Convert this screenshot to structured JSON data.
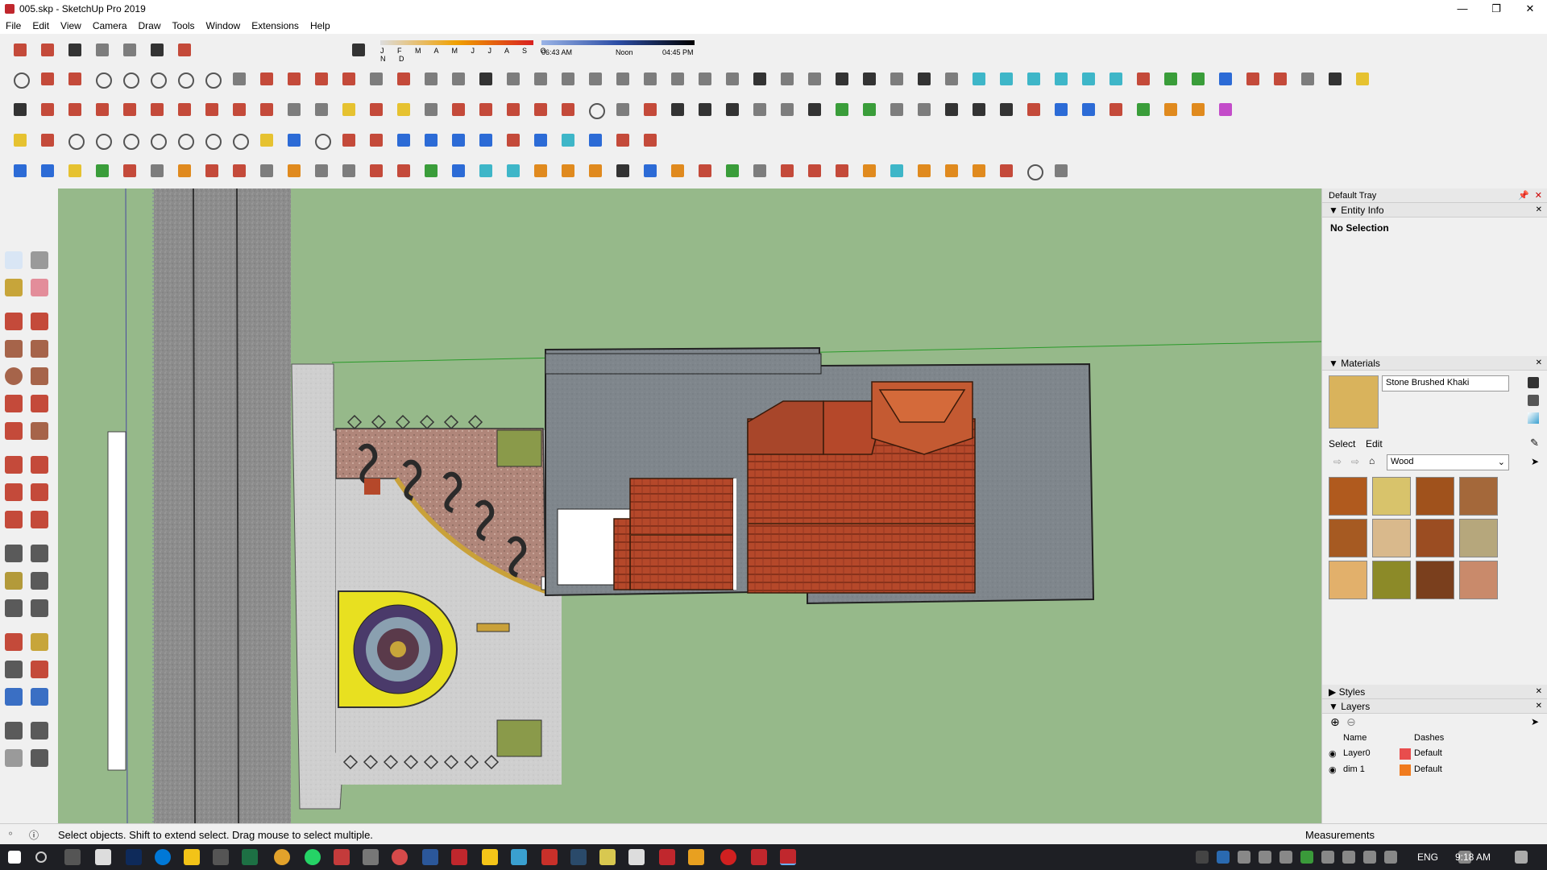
{
  "window": {
    "title": "005.skp - SketchUp Pro 2019",
    "minimize_icon": "minimize-icon",
    "maximize_icon": "restore-icon",
    "close_icon": "close-icon"
  },
  "menu": [
    "File",
    "Edit",
    "View",
    "Camera",
    "Draw",
    "Tools",
    "Window",
    "Extensions",
    "Help"
  ],
  "shadow_settings": {
    "months": "J F M A M J J A S O N D",
    "time_start": "06:43 AM",
    "time_mid": "Noon",
    "time_end": "04:45 PM"
  },
  "tray": {
    "title": "Default Tray",
    "entity_info": {
      "header": "Entity Info",
      "selection": "No Selection"
    },
    "materials": {
      "header": "Materials",
      "current_name": "Stone Brushed Khaki",
      "tab_select": "Select",
      "tab_edit": "Edit",
      "library": "Wood",
      "swatches": [
        "#b05a1e",
        "#d8c36b",
        "#a0521c",
        "#a4683a",
        "#a65a22",
        "#d9b98c",
        "#9b4d22",
        "#b6a77c",
        "#e2b06b",
        "#8c8a28",
        "#7a3f1d",
        "#c98a6b"
      ]
    },
    "styles": {
      "header": "Styles"
    },
    "layers": {
      "header": "Layers",
      "col_name": "Name",
      "col_dashes": "Dashes",
      "rows": [
        {
          "name": "Layer0",
          "dashes": "Default",
          "color": "#e84d4d"
        },
        {
          "name": "dim 1",
          "dashes": "Default",
          "color": "#f07b1e"
        }
      ]
    }
  },
  "status": {
    "hint": "Select objects. Shift to extend select. Drag mouse to select multiple.",
    "measurements": "Measurements"
  },
  "taskbar": {
    "language": "ENG",
    "time": "9:18 AM"
  }
}
